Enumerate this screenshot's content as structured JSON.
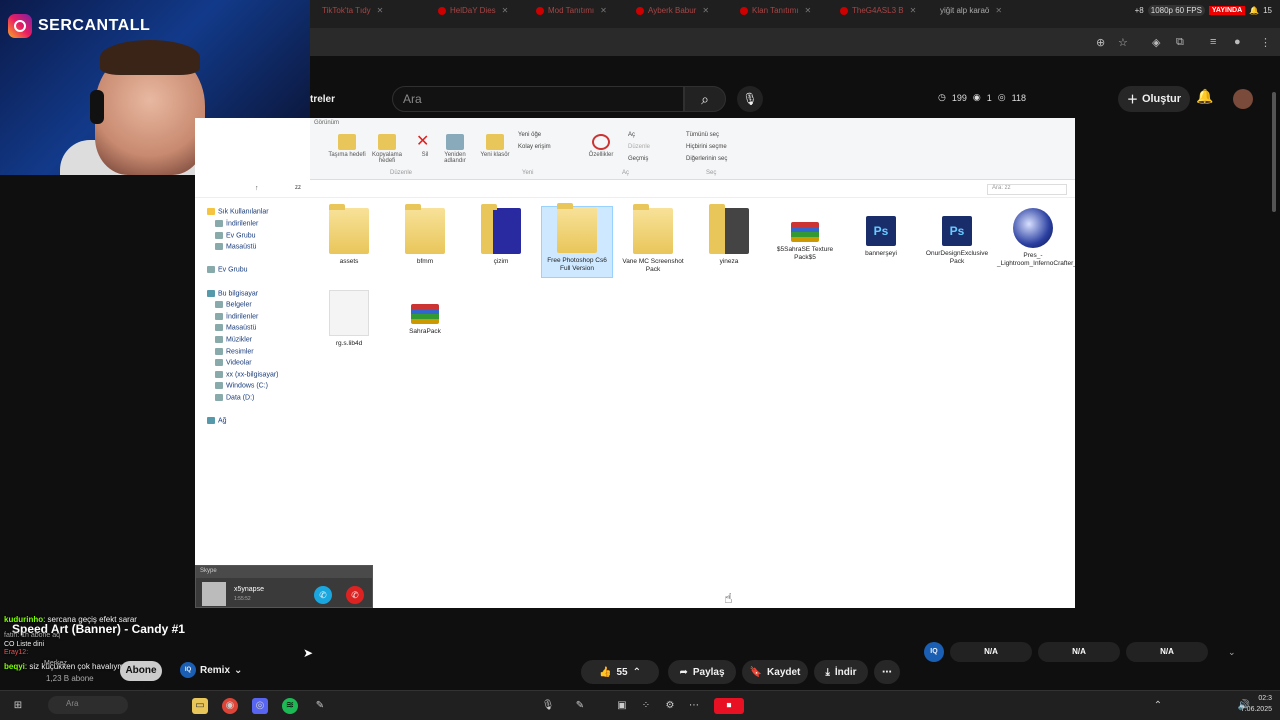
{
  "browser": {
    "tabs": [
      "TikTok'ta Tıdy",
      "HelDaY Dies",
      "Mod Tanıtımı",
      "Ayberk Babur",
      "Klan Tanıtımı",
      "TheG4ASL3 B",
      "yiğit alp karaö"
    ],
    "status": {
      "fps": "1080p 60 FPS",
      "live": "YAYINDA",
      "count": "15",
      "extra": "+8"
    }
  },
  "youtube": {
    "nav_fragment": "treler",
    "search_placeholder": "Ara",
    "stats": {
      "a": "199",
      "b": "1",
      "c": "118"
    },
    "create_label": "Oluştur"
  },
  "streamer": {
    "handle": "SERCANTALL"
  },
  "explorer": {
    "ribbon": {
      "tab": "Görünüm",
      "buttons": [
        "Taşıma hedefi",
        "Kopyalama hedefi",
        "Sil",
        "Yeniden adlandır",
        "Yeni klasör",
        "Özellikler"
      ],
      "small": [
        "Yeni öğe",
        "Kolay erişim",
        "Aç",
        "Düzenle",
        "Geçmiş",
        "Tümünü seç",
        "Hiçbirini seçme",
        "Diğerlerinin seç"
      ],
      "groups": [
        "Düzenle",
        "Yeni",
        "Aç",
        "Seç"
      ]
    },
    "path": "zz",
    "search_placeholder": "Ara: zz",
    "nav_items": [
      "Sık Kullanılanlar",
      "İndirilenler",
      "Ev Grubu",
      "Masaüstü",
      "Ev Grubu",
      "Bu bilgisayar",
      "Belgeler",
      "İndirilenler",
      "Masaüstü",
      "Müzikler",
      "Resimler",
      "Videolar",
      "xx (xx-bilgisayar)",
      "Windows (C:)",
      "Data (D:)",
      "Ağ"
    ],
    "files": [
      {
        "name": "assets",
        "type": "folder"
      },
      {
        "name": "bfmm",
        "type": "folder"
      },
      {
        "name": "çizim",
        "type": "folder"
      },
      {
        "name": "Free Photoshop Cs6 Full Version",
        "type": "folder"
      },
      {
        "name": "Vane MC Screenshot Pack",
        "type": "folder"
      },
      {
        "name": "yineza",
        "type": "folder"
      },
      {
        "name": "$5SahraSE Texture Pack$5",
        "type": "rar"
      },
      {
        "name": "bannerşeyi",
        "type": "psd"
      },
      {
        "name": "OnurDesignExclusive Pack",
        "type": "psd"
      },
      {
        "name": "Pres_-_Lightroom_InfernoCrafter_LR_Edit",
        "type": "c4d"
      },
      {
        "name": "rg.s.lib4d",
        "type": "blank"
      },
      {
        "name": "SahraPack",
        "type": "rar"
      }
    ]
  },
  "call": {
    "app": "Skype",
    "name": "x5ynapse",
    "time": "1:55:52"
  },
  "chat": [
    {
      "user": "kudurinho",
      "text": ": sercana geçiş efekt sarar"
    },
    {
      "user": "fatih",
      "text": ": 1h abone aq"
    },
    {
      "user": "",
      "text": "CO Liste dini"
    },
    {
      "user": "Eray12",
      "text": ":"
    },
    {
      "user": "beqyi",
      "text": ": siz küçükken çok havalıymışsınız"
    },
    {
      "user": "",
      "text": "Merkez"
    }
  ],
  "player": {
    "title": "Speed Art (Banner) - Candy #1",
    "subs": "1,23 B abone",
    "subscribe": "Abone ol",
    "remix": "Remix",
    "likes": "55",
    "share": "Paylaş",
    "save": "Kaydet",
    "download": "İndir",
    "iq": [
      "N/A",
      "N/A",
      "N/A"
    ]
  },
  "taskbar": {
    "search": "Ara",
    "time": "02:3",
    "date": "7.06.2025"
  }
}
